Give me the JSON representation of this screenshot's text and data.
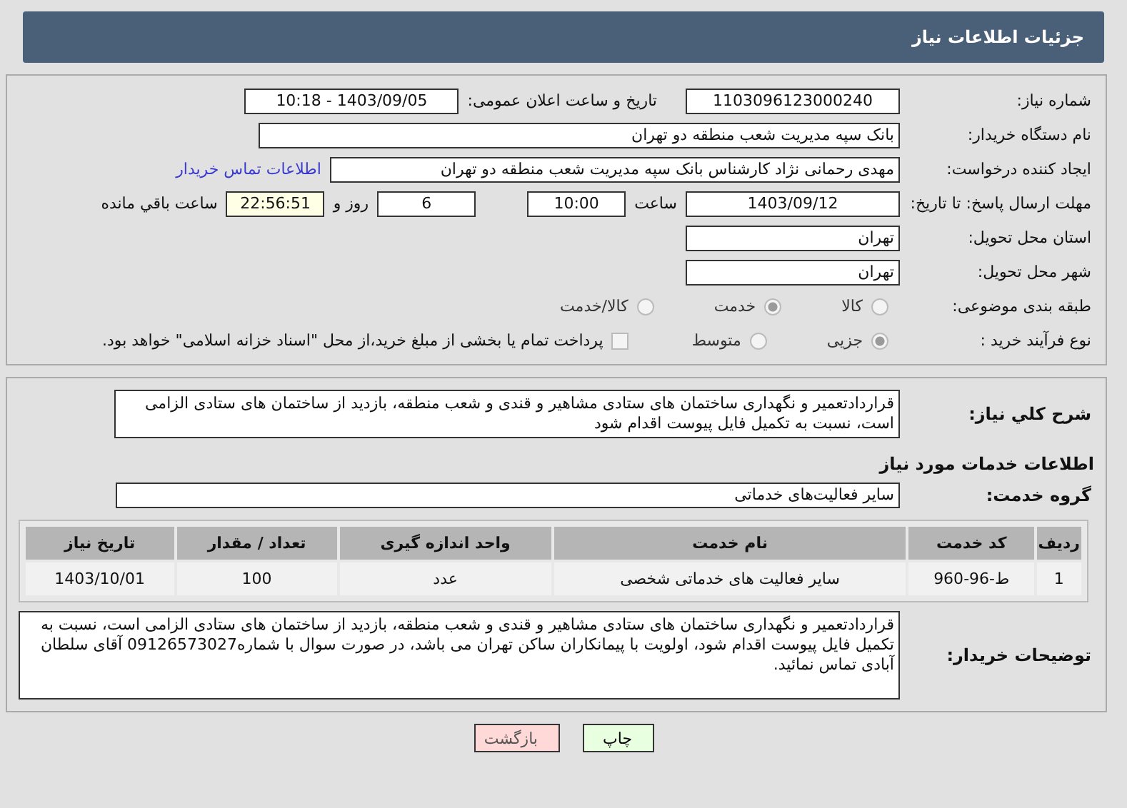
{
  "header": {
    "title": "جزئیات اطلاعات نیاز"
  },
  "need_number": {
    "label": "شماره نیاز:",
    "value": "1103096123000240"
  },
  "announce": {
    "label": "تاریخ و ساعت اعلان عمومی:",
    "value": "1403/09/05 - 10:18"
  },
  "buyer_org": {
    "label": "نام دستگاه خریدار:",
    "value": "بانک سپه مدیریت شعب منطقه دو تهران"
  },
  "creator": {
    "label": "ایجاد کننده درخواست:",
    "value": "مهدی رحمانی نژاد کارشناس بانک سپه مدیریت شعب منطقه دو تهران",
    "link": "اطلاعات تماس خریدار"
  },
  "deadline": {
    "label": "مهلت ارسال پاسخ: تا تاریخ:",
    "date": "1403/09/12",
    "time_label": "ساعت",
    "time": "10:00",
    "days": "6",
    "days_label": "روز و",
    "remaining": "22:56:51",
    "remaining_label": "ساعت باقي مانده"
  },
  "province": {
    "label": "استان محل تحویل:",
    "value": "تهران"
  },
  "city": {
    "label": "شهر محل تحویل:",
    "value": "تهران"
  },
  "category": {
    "label": "طبقه بندی موضوعی:",
    "options": [
      {
        "label": "کالا",
        "selected": false
      },
      {
        "label": "خدمت",
        "selected": true
      },
      {
        "label": "کالا/خدمت",
        "selected": false
      }
    ]
  },
  "purchase_type": {
    "label": "نوع فرآیند خرید :",
    "options": [
      {
        "label": "جزیی",
        "selected": true
      },
      {
        "label": "متوسط",
        "selected": false
      }
    ],
    "payment": {
      "checked": false,
      "text": "پرداخت تمام یا بخشی از مبلغ خرید،از محل \"اسناد خزانه اسلامی\" خواهد بود."
    }
  },
  "description": {
    "label": "شرح کلي نیاز:",
    "value": "قراردادتعمیر و نگهداری ساختمان های ستادی مشاهیر و قندی و شعب منطقه، بازدید از ساختمان های ستادی الزامی است، نسبت به تکمیل فایل پیوست اقدام شود"
  },
  "services_heading": "اطلاعات خدمات مورد نیاز",
  "service_group": {
    "label": "گروه خدمت:",
    "value": "سایر فعالیت‌های خدماتی"
  },
  "table": {
    "columns": [
      "ردیف",
      "کد خدمت",
      "نام خدمت",
      "واحد اندازه گیری",
      "تعداد / مقدار",
      "تاریخ نیاز"
    ],
    "rows": [
      [
        "1",
        "ط-96-960",
        "سایر فعالیت های خدماتی شخصی",
        "عدد",
        "100",
        "1403/10/01"
      ]
    ]
  },
  "buyer_notes": {
    "label": "توضیحات خریدار:",
    "value": "قراردادتعمیر و نگهداری ساختمان های ستادی مشاهیر و قندی و شعب منطقه، بازدید از ساختمان های ستادی الزامی است، نسبت به تکمیل فایل پیوست اقدام شود، اولویت با پیمانکاران ساکن تهران می باشد، در صورت سوال با شماره09126573027 آقای سلطان آبادی تماس نمائید."
  },
  "buttons": [
    {
      "label": "چاپ",
      "kind": "print"
    },
    {
      "label": "بازگشت",
      "kind": "back"
    }
  ]
}
